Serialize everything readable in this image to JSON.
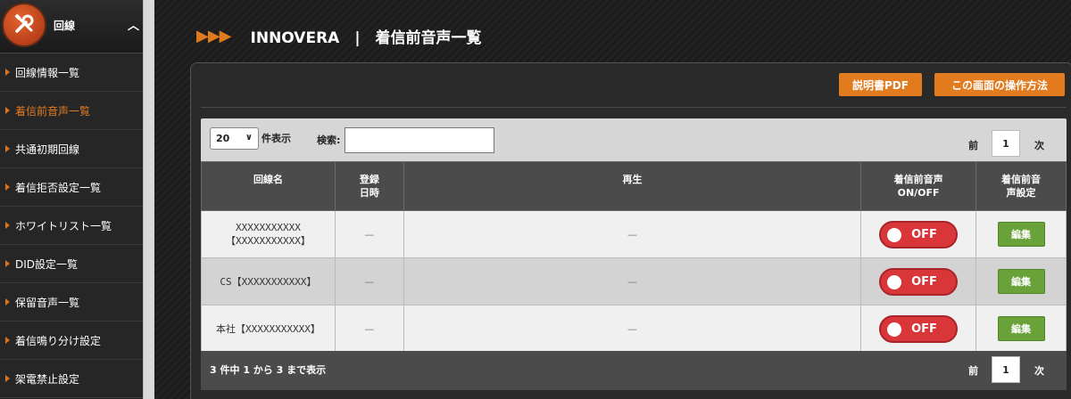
{
  "sidebar": {
    "header_title": "回線",
    "items": [
      {
        "label": "回線情報一覧",
        "active": false
      },
      {
        "label": "着信前音声一覧",
        "active": true
      },
      {
        "label": "共通初期回線",
        "active": false
      },
      {
        "label": "着信拒否設定一覧",
        "active": false
      },
      {
        "label": "ホワイトリスト一覧",
        "active": false
      },
      {
        "label": "DID設定一覧",
        "active": false
      },
      {
        "label": "保留音声一覧",
        "active": false
      },
      {
        "label": "着信鳴り分け設定",
        "active": false
      },
      {
        "label": "架電禁止設定",
        "active": false
      }
    ]
  },
  "header": {
    "arrows": "▶▶▶",
    "title": "INNOVERA　|　着信前音声一覧"
  },
  "actions": {
    "manual_pdf": "説明書PDF",
    "how_to": "この画面の操作方法"
  },
  "controls": {
    "page_size": "20",
    "page_size_suffix": "件表示",
    "search_label": "検索:",
    "search_value": "",
    "prev": "前",
    "page": "1",
    "next": "次"
  },
  "table": {
    "headers": {
      "name": "回線名",
      "registered_1": "登録",
      "registered_2": "日時",
      "play": "再生",
      "toggle_1": "着信前音声",
      "toggle_2": "ON/OFF",
      "settings_1": "着信前音",
      "settings_2": "声設定"
    },
    "rows": [
      {
        "name_1": "XXXXXXXXXXX",
        "name_2": "【XXXXXXXXXXX】",
        "registered": "—",
        "play": "—",
        "toggle": "OFF",
        "edit": "編集"
      },
      {
        "name_1": "CS【XXXXXXXXXXX】",
        "name_2": "",
        "registered": "—",
        "play": "—",
        "toggle": "OFF",
        "edit": "編集"
      },
      {
        "name_1": "本社【XXXXXXXXXXX】",
        "name_2": "",
        "registered": "—",
        "play": "—",
        "toggle": "OFF",
        "edit": "編集"
      }
    ]
  },
  "footer": {
    "summary": "3 件中 1 から 3 まで表示",
    "prev": "前",
    "page": "1",
    "next": "次"
  },
  "colors": {
    "accent_orange": "#e27a1e",
    "toggle_red": "#d9363a",
    "edit_green": "#6aa23a"
  }
}
